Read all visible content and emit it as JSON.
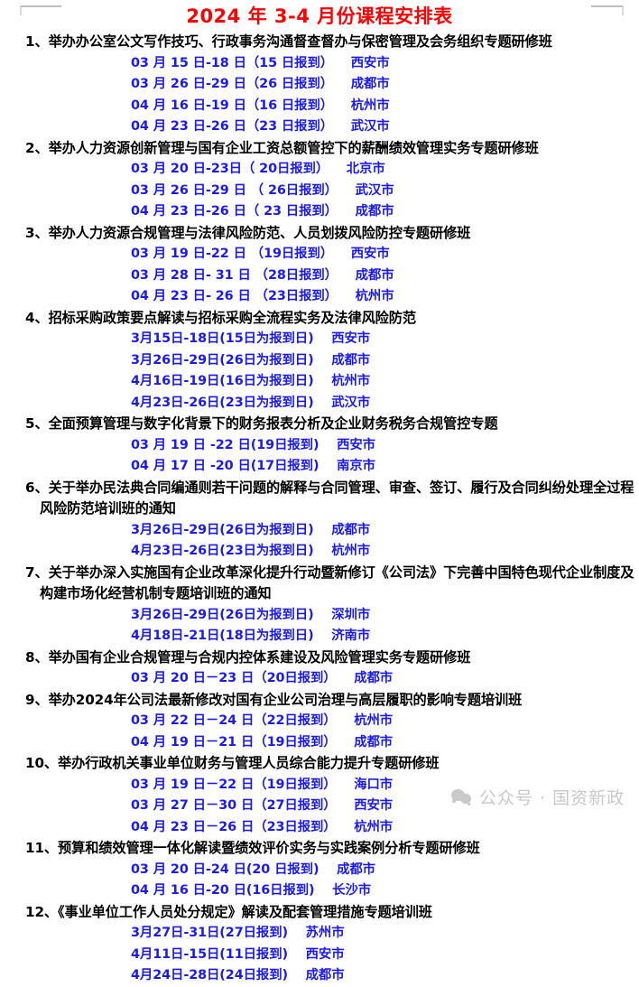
{
  "document": {
    "title": "2024 年 3-4 月份课程安排表",
    "title_color": "#ff0000",
    "title_text_color": "#000000",
    "session_text_color": "#1a1aee"
  },
  "watermark": {
    "icon": "wechat-icon",
    "text": "公众号 · 国资新政"
  },
  "courses": [
    {
      "number": "1、",
      "title": "举办办公室公文写作技巧、行政事务沟通督查督办与保密管理及会务组织专题研修班",
      "title_line2": "",
      "sessions": [
        {
          "date": "03 月 15 日-18 日（15 日报到）",
          "city": "西安市"
        },
        {
          "date": "03 月 26 日-29 日（26 日报到）",
          "city": "成都市"
        },
        {
          "date": "04 月 16 日-19 日（16 日报到）",
          "city": "杭州市"
        },
        {
          "date": "04 月 23 日-26 日（23 日报到）",
          "city": "武汉市"
        }
      ]
    },
    {
      "number": "2、",
      "title": "举办人力资源创新管理与国有企业工资总额管控下的薪酬绩效管理实务专题研修班",
      "title_line2": "",
      "sessions": [
        {
          "date": "03 月 20 日-23日（ 20日报到）",
          "city": "北京市"
        },
        {
          "date": "03 月 26 日-29 日 （ 26日报到）",
          "city": "武汉市"
        },
        {
          "date": "04 月 23 日-26 日（ 23 日报到）",
          "city": "成都市"
        }
      ]
    },
    {
      "number": "3、",
      "title": "举办人力资源合规管理与法律风险防范、人员划拨风险防控专题研修班",
      "title_line2": "",
      "sessions": [
        {
          "date": "03 月 19 日-22 日 （19日报到）",
          "city": "西安市"
        },
        {
          "date": "03 月 28 日- 31 日 （28日报到）",
          "city": "成都市"
        },
        {
          "date": "04 月 23 日- 26 日 （23日报到）",
          "city": "杭州市"
        }
      ]
    },
    {
      "number": "4、",
      "title": "招标采购政策要点解读与招标采购全流程实务及法律风险防范",
      "title_line2": "",
      "sessions": [
        {
          "date": "3月15日-18日(15日为报到日)",
          "city": "西安市"
        },
        {
          "date": "3月26日-29日(26日为报到日)",
          "city": "成都市"
        },
        {
          "date": "4月16日-19日(16日为报到日)",
          "city": "杭州市"
        },
        {
          "date": "4月23日-26日(23日为报到日)",
          "city": "武汉市"
        }
      ]
    },
    {
      "number": "5、",
      "title": "全面预算管理与数字化背景下的财务报表分析及企业财务税务合规管控专题",
      "title_line2": "",
      "sessions": [
        {
          "date": "03 月 19 日 -22 日(19日报到)",
          "city": "西安市"
        },
        {
          "date": "04 月 17 日 -20 日(17日报到)",
          "city": "南京市"
        }
      ]
    },
    {
      "number": "6、",
      "title": "关于举办民法典合同编通则若干问题的解释与合同管理、审查、签订、履行及合同纠纷处理全过程",
      "title_line2": "风险防范培训班的通知",
      "sessions": [
        {
          "date": "3月26日-29日(26日为报到日)",
          "city": "成都市"
        },
        {
          "date": "4月23日-26日(23日为报到日)",
          "city": "杭州市"
        }
      ]
    },
    {
      "number": "7、",
      "title": "关于举办深入实施国有企业改革深化提升行动暨新修订《公司法》下完善中国特色现代企业制度及",
      "title_line2": "构建市场化经营机制专题培训班的通知",
      "sessions": [
        {
          "date": "3月26日-29日(26日为报到日)",
          "city": "深圳市"
        },
        {
          "date": "4月18日-21日(18日为报到日)",
          "city": "济南市"
        }
      ]
    },
    {
      "number": "8、",
      "title": "举办国有企业合规管理与合规内控体系建设及风险管理实务专题研修班",
      "title_line2": "",
      "sessions": [
        {
          "date": "03 月 20 日－23 日（20日报到）",
          "city": "成都市"
        }
      ]
    },
    {
      "number": "9、",
      "title": "举办2024年公司法最新修改对国有企业公司治理与高层履职的影响专题培训班",
      "title_line2": "",
      "sessions": [
        {
          "date": "03 月 22 日－24 日（22日报到）",
          "city": "杭州市"
        },
        {
          "date": "04 月 19 日－21 日（19日报到）",
          "city": "成都市"
        }
      ]
    },
    {
      "number": "10、",
      "title": "举办行政机关事业单位财务与管理人员综合能力提升专题研修班",
      "title_line2": "",
      "sessions": [
        {
          "date": "03 月 19 日－22 日（19日报到）",
          "city": "海口市"
        },
        {
          "date": "03 月 27 日－30 日（27日报到）",
          "city": "西安市"
        },
        {
          "date": "04 月 23 日－26 日（23日报到）",
          "city": "杭州市"
        }
      ]
    },
    {
      "number": "11、",
      "title": "预算和绩效管理一体化解读暨绩效评价实务与实践案例分析专题研修班",
      "title_line2": "",
      "sessions": [
        {
          "date": "03 月 20 日-24 日(20 日报到)",
          "city": "成都市"
        },
        {
          "date": "04 月 16 日-20 日(16日报到)",
          "city": "长沙市"
        }
      ]
    },
    {
      "number": "12、",
      "title": "《事业单位工作人员处分规定》解读及配套管理措施专题培训班",
      "title_line2": "",
      "sessions": [
        {
          "date": "3月27日-31日(27日报到)",
          "city": "苏州市"
        },
        {
          "date": "4月11日-15日(11日报到)",
          "city": "西安市"
        },
        {
          "date": "4月24日-28日(24日报到)",
          "city": "成都市"
        }
      ]
    }
  ]
}
